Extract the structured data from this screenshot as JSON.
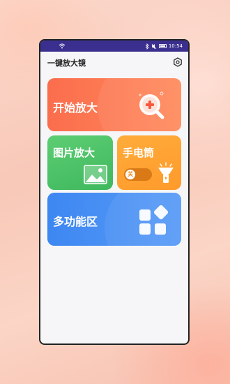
{
  "app": {
    "title": "一键放大镜"
  },
  "status_bar": {
    "time": "10:54",
    "bg_color": "#3a2f8e",
    "icons": [
      "wifi-icon",
      "bluetooth-icon",
      "mute-icon",
      "battery-icon"
    ]
  },
  "cards": {
    "start_magnify": {
      "label": "开始放大",
      "color": "#fb6d4d",
      "icon": "magnifier-plus-icon"
    },
    "image_magnify": {
      "label": "图片放大",
      "color": "#4cc066",
      "icon": "image-icon"
    },
    "flashlight": {
      "label": "手电筒",
      "color": "#ffa232",
      "icon": "flashlight-icon",
      "toggle_label": "关",
      "toggle_on": false
    },
    "multi_function": {
      "label": "多功能区",
      "color": "#4a90f4",
      "icon": "apps-grid-icon"
    }
  },
  "header": {
    "settings_icon": "settings-icon"
  }
}
